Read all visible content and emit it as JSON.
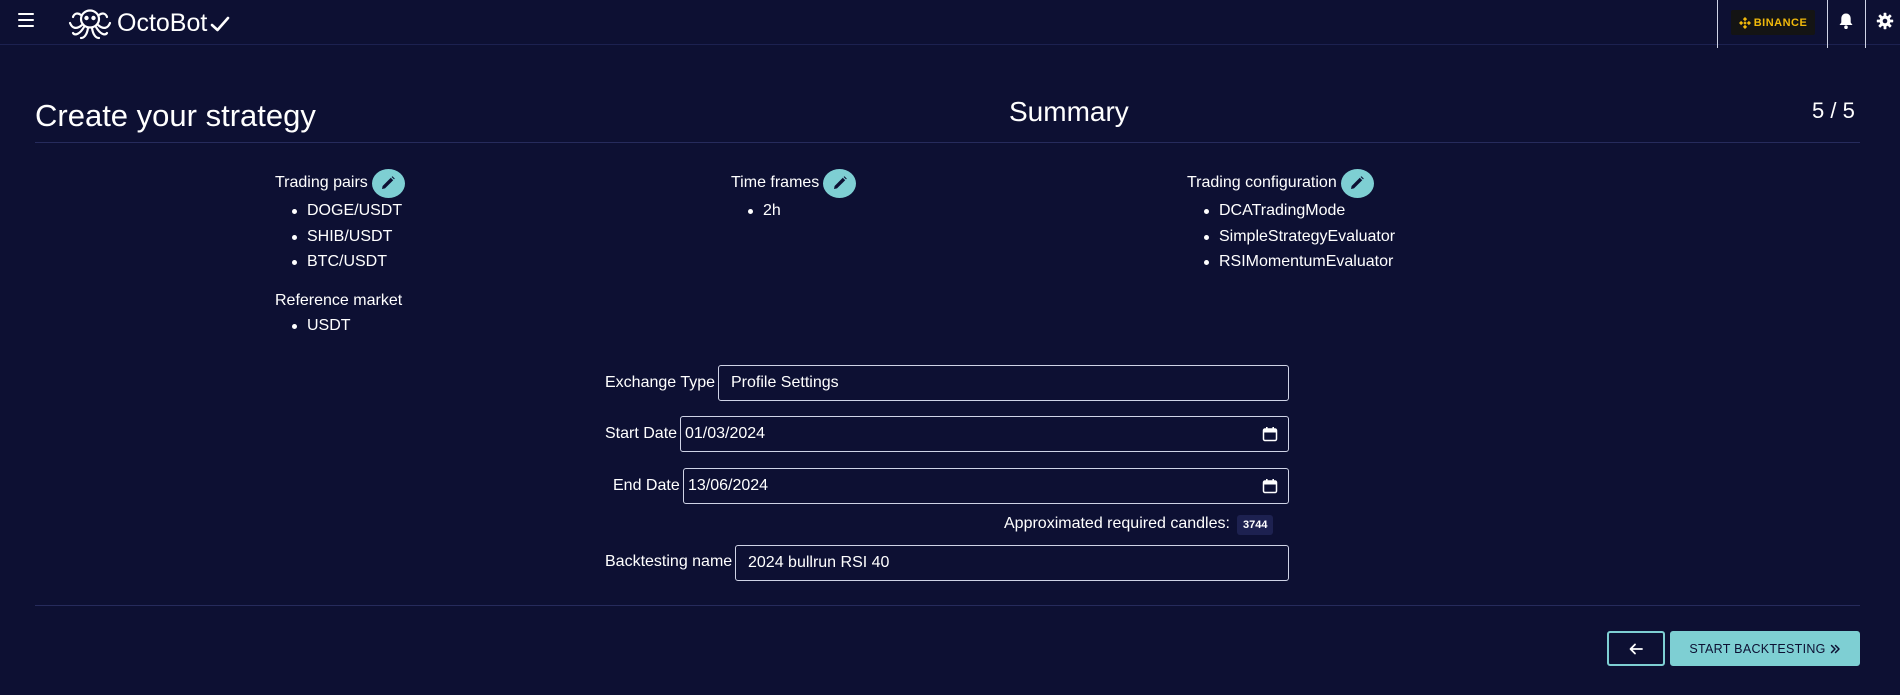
{
  "app": {
    "brand": "OctoBot",
    "exchange": "BINANCE"
  },
  "header": {
    "page_title": "Create your strategy",
    "step_title": "Summary",
    "step_count": "5 / 5"
  },
  "summary": {
    "trading_pairs": {
      "label": "Trading pairs",
      "items": [
        "DOGE/USDT",
        "SHIB/USDT",
        "BTC/USDT"
      ]
    },
    "reference_market": {
      "label": "Reference market",
      "items": [
        "USDT"
      ]
    },
    "time_frames": {
      "label": "Time frames",
      "items": [
        "2h"
      ]
    },
    "trading_configuration": {
      "label": "Trading configuration",
      "items": [
        "DCATradingMode",
        "SimpleStrategyEvaluator",
        "RSIMomentumEvaluator"
      ]
    }
  },
  "form": {
    "exchange_type": {
      "label": "Exchange Type",
      "value": "Profile Settings"
    },
    "start_date": {
      "label": "Start Date",
      "value": "01/03/2024"
    },
    "end_date": {
      "label": "End Date",
      "value": "13/06/2024"
    },
    "candles": {
      "label": "Approximated required candles:",
      "value": "3744"
    },
    "backtesting_name": {
      "label": "Backtesting name",
      "value": "2024 bullrun RSI 40"
    }
  },
  "footer": {
    "start_label": "START BACKTESTING"
  },
  "colors": {
    "background": "#0d1033",
    "accent": "#7ecfd3",
    "exchange_brand": "#f0b90b"
  },
  "icons": {
    "menu": "hamburger-icon",
    "logo": "octopus-logo-icon",
    "verified": "check-icon",
    "notifications": "bell-icon",
    "settings": "gear-icon",
    "edit": "pencil-icon",
    "calendar": "calendar-icon",
    "back": "arrow-left-icon",
    "forward": "double-chevron-right-icon"
  }
}
